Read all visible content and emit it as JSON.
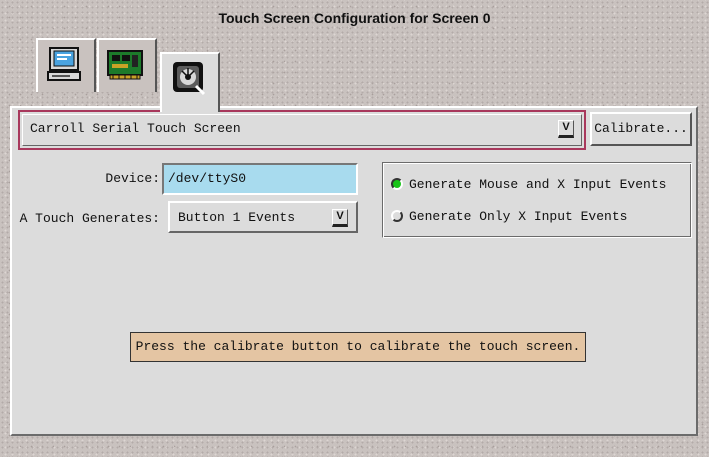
{
  "window": {
    "title": "Touch Screen Configuration for Screen 0"
  },
  "tabs": [
    {
      "icon": "monitor-icon"
    },
    {
      "icon": "circuit-board-icon"
    },
    {
      "icon": "touch-screen-icon",
      "selected": true
    }
  ],
  "panel": {
    "driver_combo": {
      "value": "Carroll Serial Touch Screen",
      "arrow": "V"
    },
    "calibrate_button": "Calibrate...",
    "device": {
      "label": "Device:",
      "value": "/dev/ttyS0"
    },
    "touch_generates": {
      "label": "A Touch Generates:",
      "value": "Button 1 Events",
      "arrow": "V"
    },
    "event_options": [
      {
        "label": "Generate Mouse and X Input Events",
        "selected": true
      },
      {
        "label": "Generate Only X Input Events",
        "selected": false
      }
    ],
    "message": "Press the calibrate button to calibrate the touch screen."
  },
  "colors": {
    "background": "#c9c2bf",
    "panel": "#dcdcdc",
    "input_bg": "#a8dbee",
    "message_bg": "#e4c5a3",
    "radio_on": "#19c419",
    "focus_border": "#a8385c"
  }
}
